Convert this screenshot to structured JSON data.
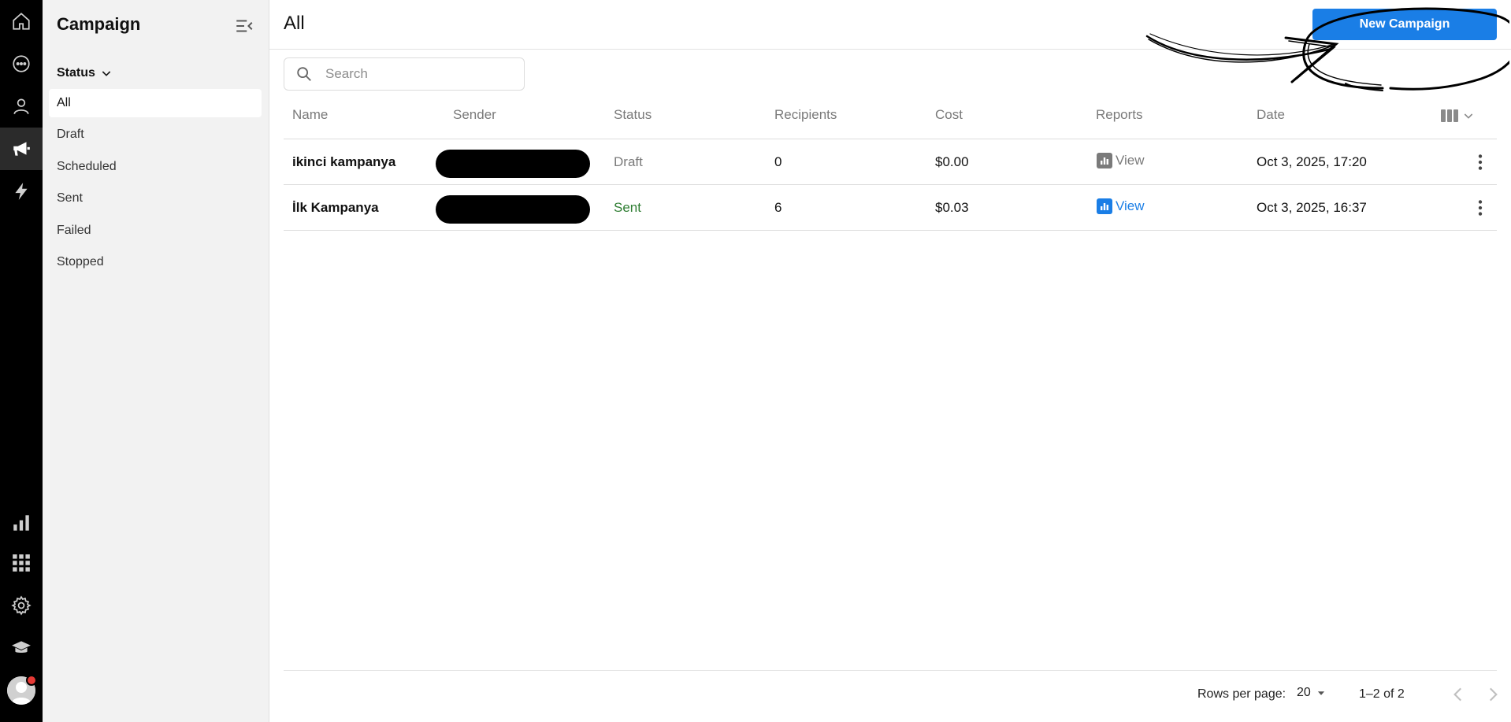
{
  "rail": {
    "items": [
      "home-icon",
      "chat-icon",
      "user-icon",
      "megaphone-icon",
      "lightning-icon",
      "bar-chart-icon",
      "apps-grid-icon",
      "gear-icon",
      "graduation-cap-icon"
    ],
    "active": "megaphone-icon"
  },
  "sidebar": {
    "title": "Campaign",
    "section_label": "Status",
    "items": [
      {
        "label": "All",
        "active": true
      },
      {
        "label": "Draft"
      },
      {
        "label": "Scheduled"
      },
      {
        "label": "Sent"
      },
      {
        "label": "Failed"
      },
      {
        "label": "Stopped"
      }
    ]
  },
  "header": {
    "title": "All",
    "new_button_label": "New Campaign"
  },
  "search": {
    "placeholder": "Search",
    "value": ""
  },
  "table": {
    "columns": [
      "Name",
      "Sender",
      "Status",
      "Recipients",
      "Cost",
      "Reports",
      "Date"
    ],
    "rows": [
      {
        "name": "ikinci kampanya",
        "sender": "",
        "status": "Draft",
        "recipients": "0",
        "cost": "$0.00",
        "report": "View",
        "date": "Oct 3, 2025, 17:20"
      },
      {
        "name": "İlk Kampanya",
        "sender": "",
        "status": "Sent",
        "recipients": "6",
        "cost": "$0.03",
        "report": "View",
        "date": "Oct 3, 2025, 16:37"
      }
    ]
  },
  "footer": {
    "rows_per_page_label": "Rows per page:",
    "rows_per_page_value": "20",
    "range": "1–2 of 2"
  },
  "colors": {
    "accent": "#1a7ee6",
    "sent": "#2e7d32",
    "rail_bg": "#000000",
    "sidebar_bg": "#f2f2f2"
  }
}
